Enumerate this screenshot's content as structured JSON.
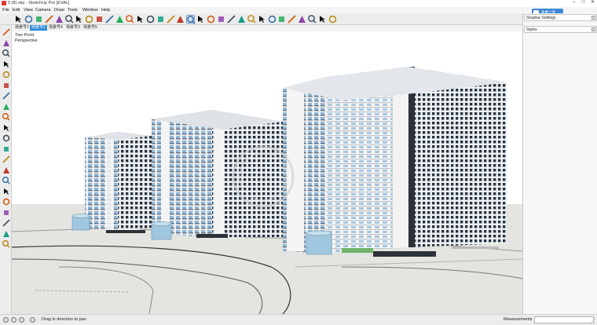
{
  "window": {
    "title": "0 (8).skp - SketchUp Pro [EVAL]",
    "controls": [
      "–",
      "□",
      "✕"
    ]
  },
  "menu": [
    "File",
    "Edit",
    "View",
    "Camera",
    "Draw",
    "Tools",
    "Window",
    "Help"
  ],
  "toolbar": {
    "tools": [
      {
        "name": "select-tool-icon",
        "active": false
      },
      {
        "name": "eraser-tool-icon",
        "active": false
      },
      {
        "name": "paint-bucket-icon",
        "active": false
      },
      {
        "name": "make-component-icon",
        "active": false
      },
      {
        "name": "line-tool-icon",
        "active": false
      },
      {
        "name": "arc-tool-icon",
        "active": false
      },
      {
        "name": "freehand-tool-icon",
        "active": false
      },
      {
        "name": "push-pull-icon",
        "active": false
      },
      {
        "name": "move-tool-icon",
        "active": false
      },
      {
        "name": "rotate-tool-icon",
        "active": false
      },
      {
        "name": "follow-me-icon",
        "active": false
      },
      {
        "name": "scale-tool-icon",
        "active": false
      },
      {
        "name": "offset-tool-icon",
        "active": false
      },
      {
        "name": "tape-measure-icon",
        "active": false
      },
      {
        "name": "dimension-tool-icon",
        "active": false
      },
      {
        "name": "protractor-icon",
        "active": false
      },
      {
        "name": "orbit-tool-icon",
        "active": false
      },
      {
        "name": "pan-tool-icon",
        "active": true
      },
      {
        "name": "zoom-tool-icon",
        "active": false
      },
      {
        "name": "zoom-window-icon",
        "active": false
      },
      {
        "name": "zoom-extents-icon",
        "active": false
      },
      {
        "name": "previous-view-icon",
        "active": false
      },
      {
        "name": "position-camera-icon",
        "active": false
      },
      {
        "name": "walk-tool-icon",
        "active": false
      },
      {
        "name": "look-around-icon",
        "active": false
      },
      {
        "name": "section-plane-icon",
        "active": false
      },
      {
        "name": "iso-view-icon",
        "active": false
      },
      {
        "name": "top-view-icon",
        "active": false
      },
      {
        "name": "front-view-icon",
        "active": false
      },
      {
        "name": "right-view-icon",
        "active": false
      },
      {
        "name": "back-view-icon",
        "active": false
      },
      {
        "name": "left-view-icon",
        "active": false
      }
    ]
  },
  "scene_tabs": [
    "场景号1",
    "场景号2",
    "场景号4",
    "场景号3",
    "场景号5"
  ],
  "active_scene_index": 1,
  "viewport": {
    "camera_mode": "Two Point",
    "projection": "Perspective"
  },
  "left_tools": [
    "axes-tool-icon",
    "sandbox-icon",
    "stamp-tool-icon",
    "shield-icon",
    "box-icon",
    "ruler-icon",
    "circle-tool-icon",
    "grid-tool-icon",
    "drape-icon",
    "target-icon",
    "flip-icon",
    "weld-icon",
    "knife-icon",
    "modules-icon",
    "gear-icon",
    "wave-icon",
    "swirl-icon",
    "cross-icon",
    "spiral-icon",
    "leaf-icon",
    "loop-icon"
  ],
  "tray": {
    "panels": [
      "Shadow Settings",
      "Styles"
    ],
    "upload_badge": "免费上传"
  },
  "status": {
    "hint": "Drag in direction to pan",
    "measurements_label": "Measurements",
    "measurements_value": ""
  },
  "colors": {
    "building_facade": "#eef0f2",
    "window_glass": "#8fb6d6",
    "dark_bands": "#2d3138",
    "ground": "#dcdcd8",
    "sky": "#ffffff",
    "water_tank": "#9fc7df",
    "accent_blue": "#2f8bd8"
  }
}
